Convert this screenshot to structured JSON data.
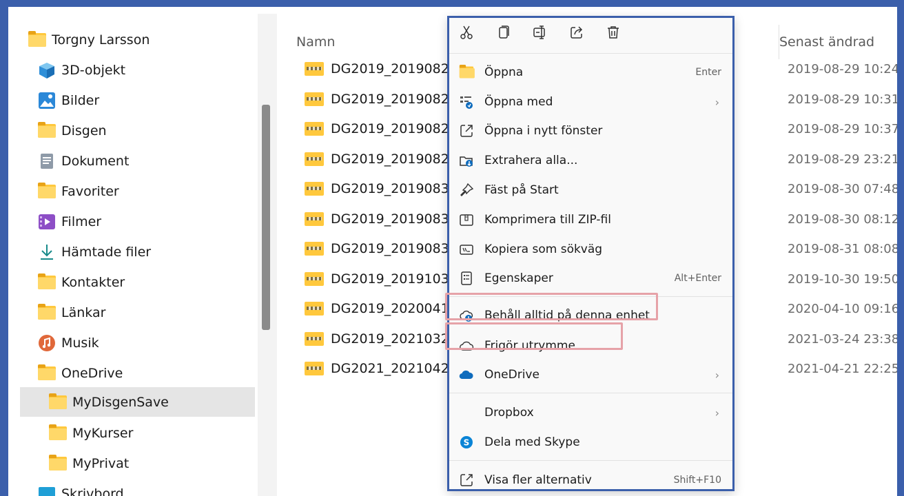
{
  "nav": {
    "items": [
      {
        "label": "Torgny Larsson",
        "icon": "folder-icon"
      },
      {
        "label": "3D-objekt",
        "icon": "cube-icon"
      },
      {
        "label": "Bilder",
        "icon": "pictures-icon"
      },
      {
        "label": "Disgen",
        "icon": "folder-icon"
      },
      {
        "label": "Dokument",
        "icon": "document-icon"
      },
      {
        "label": "Favoriter",
        "icon": "folder-icon"
      },
      {
        "label": "Filmer",
        "icon": "video-icon"
      },
      {
        "label": "Hämtade filer",
        "icon": "download-icon"
      },
      {
        "label": "Kontakter",
        "icon": "folder-icon"
      },
      {
        "label": "Länkar",
        "icon": "folder-icon"
      },
      {
        "label": "Musik",
        "icon": "music-icon"
      },
      {
        "label": "OneDrive",
        "icon": "folder-icon"
      },
      {
        "label": "MyDisgenSave",
        "icon": "folder-icon"
      },
      {
        "label": "MyKurser",
        "icon": "folder-icon"
      },
      {
        "label": "MyPrivat",
        "icon": "folder-icon"
      },
      {
        "label": "Skrivbord",
        "icon": "desktop-icon"
      }
    ]
  },
  "list": {
    "col_name": "Namn",
    "col_modified": "Senast ändrad",
    "files": [
      {
        "name": "DG2019_2019082",
        "modified": "2019-08-29 10:24"
      },
      {
        "name": "DG2019_2019082",
        "modified": "2019-08-29 10:31"
      },
      {
        "name": "DG2019_2019082",
        "modified": "2019-08-29 10:37"
      },
      {
        "name": "DG2019_2019082",
        "modified": "2019-08-29 23:21"
      },
      {
        "name": "DG2019_2019083",
        "modified": "2019-08-30 07:48"
      },
      {
        "name": "DG2019_2019083",
        "modified": "2019-08-30 08:12"
      },
      {
        "name": "DG2019_2019083",
        "modified": "2019-08-31 08:08"
      },
      {
        "name": "DG2019_2019103",
        "modified": "2019-10-30 19:50"
      },
      {
        "name": "DG2019_2020041",
        "modified": "2020-04-10 09:16"
      },
      {
        "name": "DG2019_2021032",
        "modified": "2021-03-24 23:38"
      },
      {
        "name": "DG2021_2021042",
        "modified": "2021-04-21 22:25"
      }
    ]
  },
  "menu": {
    "toolbar": [
      "cut-icon",
      "copy-icon",
      "rename-icon",
      "share-icon",
      "delete-icon"
    ],
    "items": [
      {
        "label": "Öppna",
        "shortcut": "Enter"
      },
      {
        "label": "Öppna med",
        "shortcut": ""
      },
      {
        "label": "Öppna i nytt fönster",
        "shortcut": ""
      },
      {
        "label": "Extrahera alla...",
        "shortcut": ""
      },
      {
        "label": "Fäst på Start",
        "shortcut": ""
      },
      {
        "label": "Komprimera till ZIP-fil",
        "shortcut": ""
      },
      {
        "label": "Kopiera som sökväg",
        "shortcut": ""
      },
      {
        "label": "Egenskaper",
        "shortcut": "Alt+Enter"
      },
      {
        "label": "Behåll alltid på denna enhet",
        "shortcut": ""
      },
      {
        "label": "Frigör utrymme",
        "shortcut": ""
      },
      {
        "label": "OneDrive",
        "shortcut": ""
      },
      {
        "label": "Dropbox",
        "shortcut": ""
      },
      {
        "label": "Dela med Skype",
        "shortcut": ""
      },
      {
        "label": "Visa fler alternativ",
        "shortcut": "Shift+F10"
      }
    ]
  },
  "colors": {
    "frame": "#3b5fab",
    "highlight": "#e6a2a8",
    "folder": "#ffc83d",
    "onedrive": "#0f6cbd"
  }
}
